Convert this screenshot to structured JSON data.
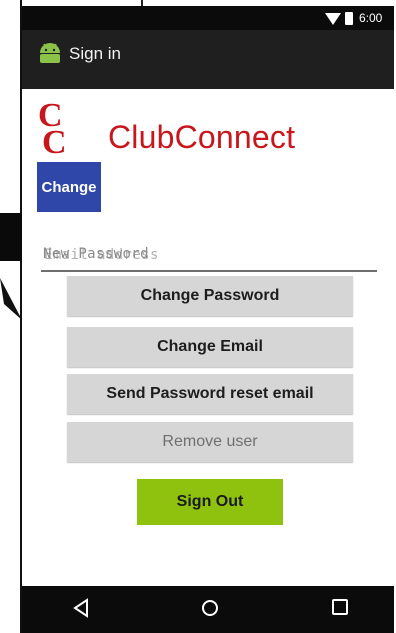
{
  "status_bar": {
    "time": "6:00",
    "icons": [
      "wifi-icon",
      "battery-icon"
    ]
  },
  "action_bar": {
    "title": "Sign in",
    "icon": "android-icon"
  },
  "app": {
    "name": "ClubConnect",
    "logo_text": "CC",
    "brand_color": "#c8161d"
  },
  "change_button": {
    "label": "Change",
    "color": "#2f47a8"
  },
  "password_field": {
    "overlay_text_a": "New Password",
    "overlay_text_b": "Email address"
  },
  "buttons": {
    "change_password": "Change Password",
    "change_email": "Change Email",
    "send_reset": "Send Password reset email",
    "remove_user": "Remove user",
    "sign_out": "Sign Out"
  },
  "colors": {
    "sign_out_bg": "#8fc10f",
    "button_bg": "#d6d6d6"
  },
  "nav_bar": {
    "icons": [
      "back-icon",
      "home-icon",
      "recent-apps-icon"
    ]
  }
}
